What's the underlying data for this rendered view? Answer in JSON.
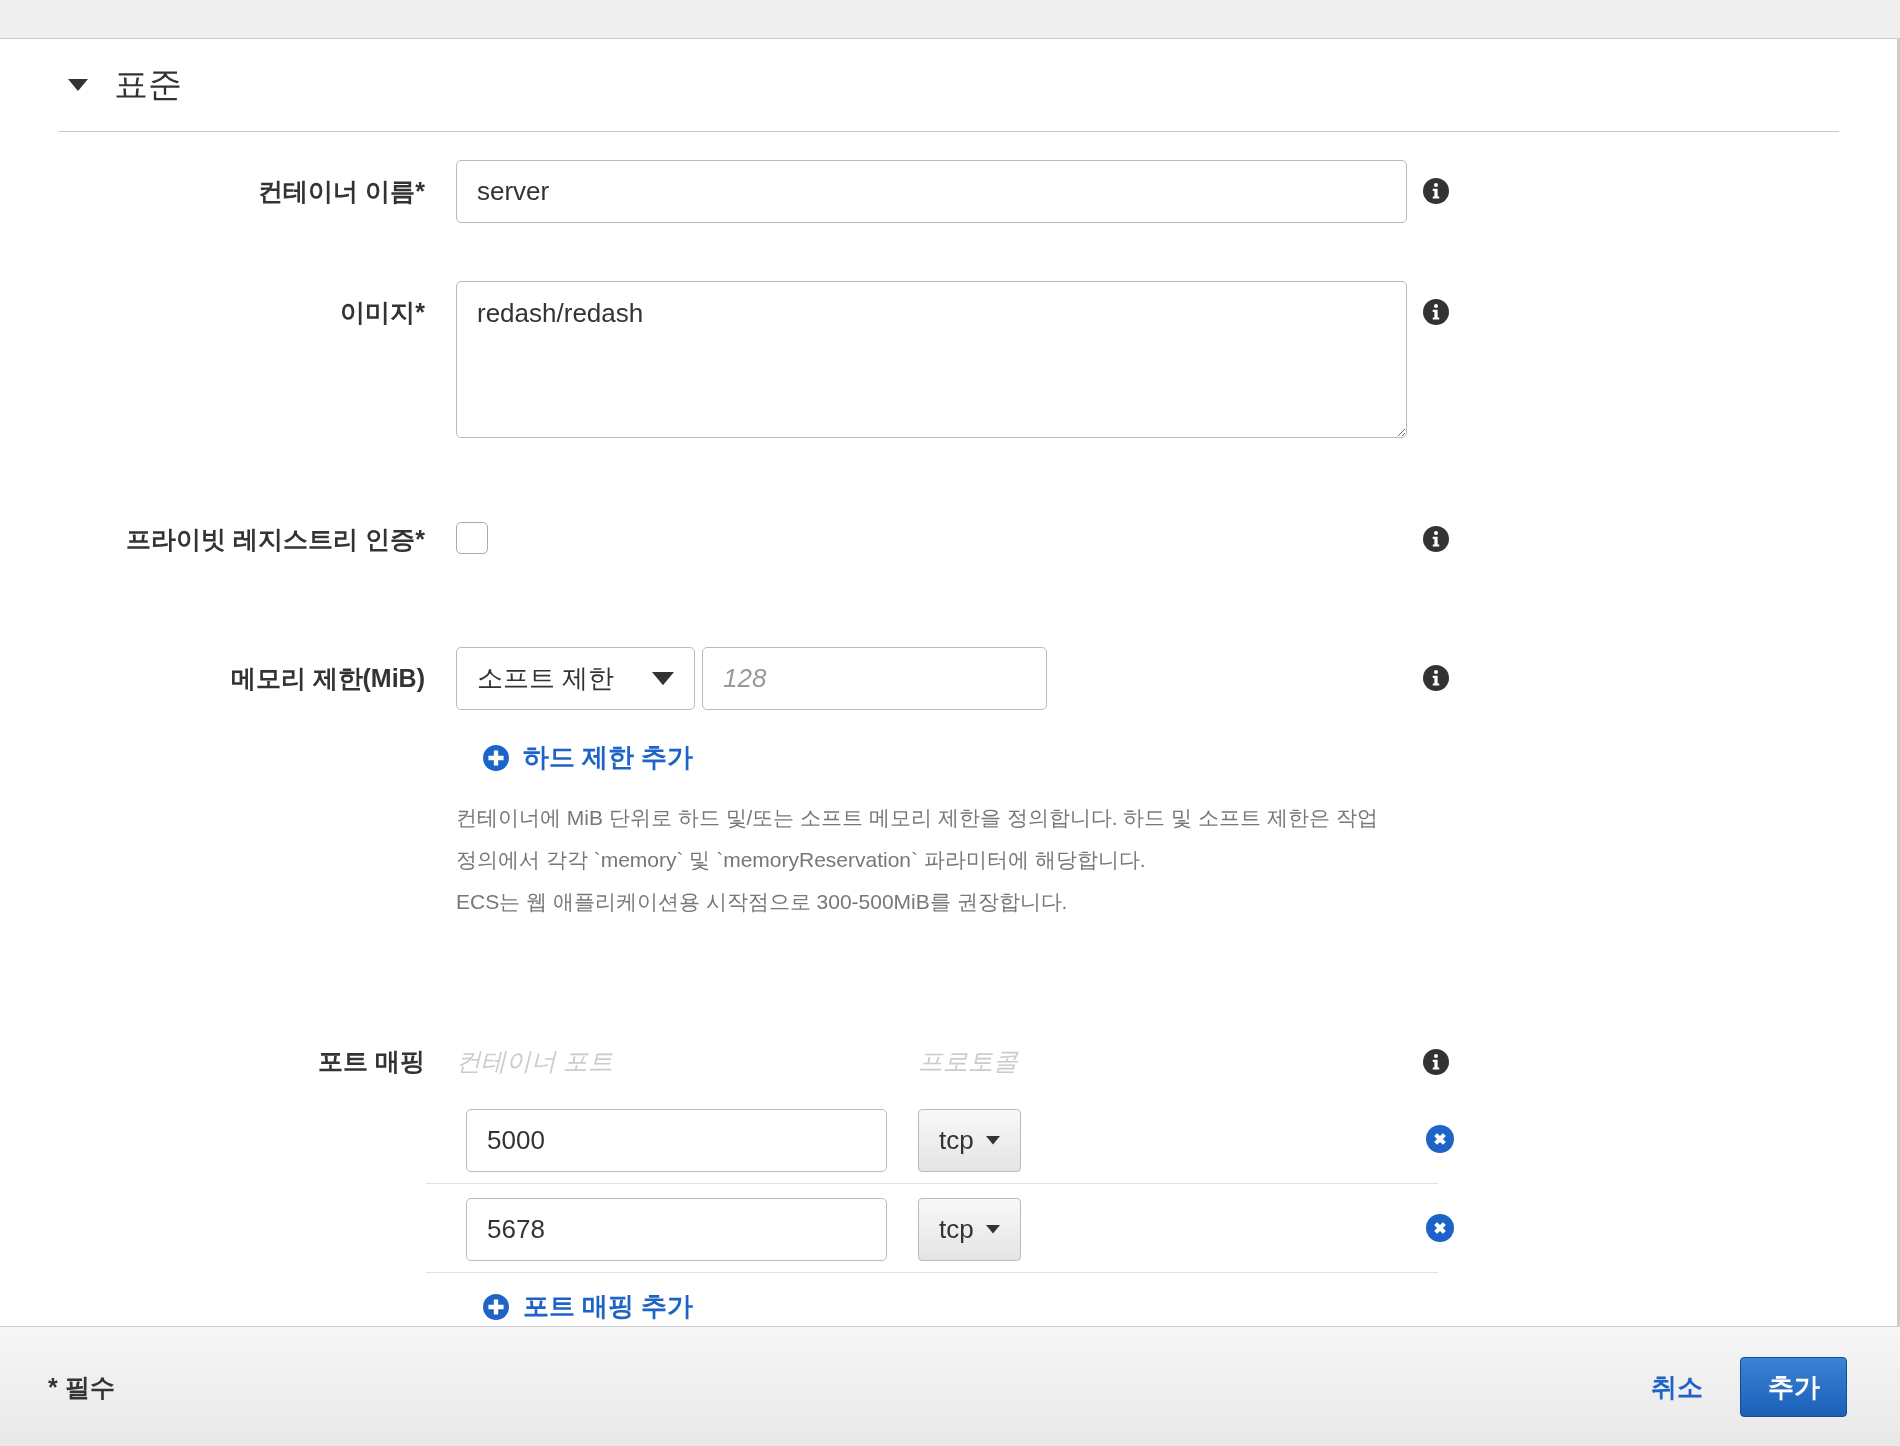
{
  "section": {
    "title": "표준",
    "expanded": true
  },
  "fields": [
    {
      "kind": "text",
      "label": "컨테이너 이름*",
      "value": "server"
    },
    {
      "kind": "textarea",
      "label": "이미지*",
      "value": "redash/redash"
    },
    {
      "kind": "checkbox",
      "label": "프라이빗 레지스트리 인증*",
      "checked": false
    },
    {
      "kind": "memory",
      "label": "메모리 제한(MiB)",
      "select": "소프트 제한",
      "placeholder": "128",
      "add_link": "하드 제한 추가",
      "help_lines": [
        "컨테이너에 MiB 단위로 하드 및/또는 소프트 메모리 제한을 정의합니다. 하드 및 소프트 제한은 작업",
        "정의에서 각각 `memory` 및 `memoryReservation` 파라미터에 해당합니다.",
        "ECS는 웹 애플리케이션용 시작점으로 300-500MiB를 권장합니다."
      ]
    }
  ],
  "port_mappings": {
    "label": "포트 매핑",
    "columns": [
      "컨테이너 포트",
      "프로토콜"
    ],
    "rows": [
      {
        "port": "5000",
        "protocol": "tcp"
      },
      {
        "port": "5678",
        "protocol": "tcp"
      }
    ],
    "add_link": "포트 매핑 추가"
  },
  "footer": {
    "required_note": "* 필수",
    "cancel": "취소",
    "add": "추가"
  }
}
